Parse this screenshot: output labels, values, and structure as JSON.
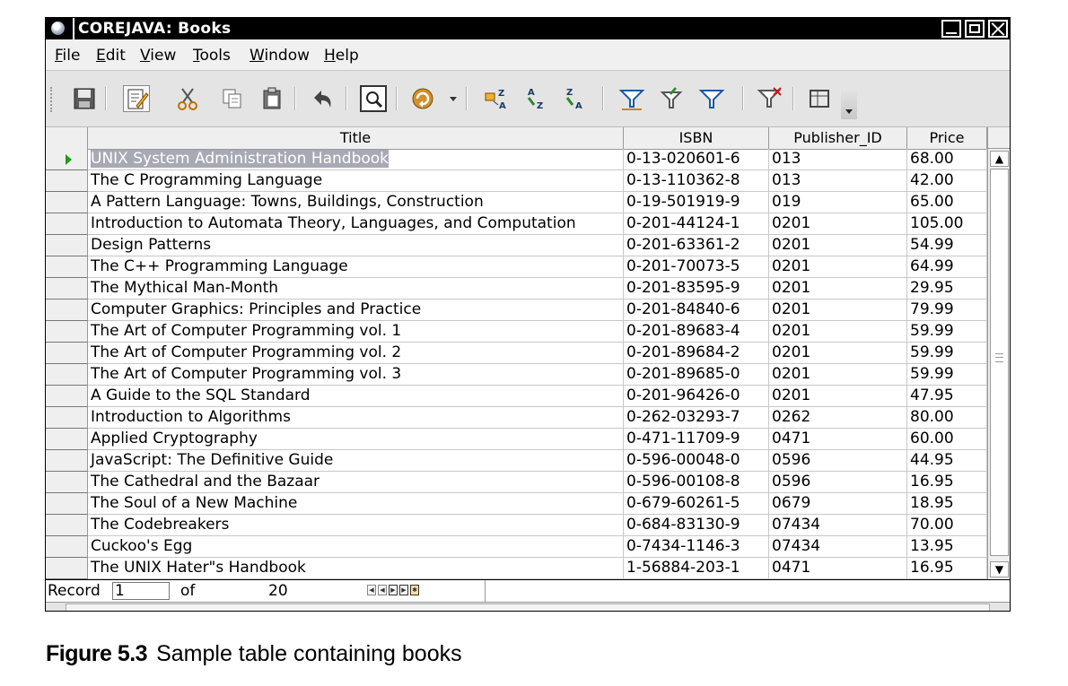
{
  "window": {
    "title": "COREJAVA: Books",
    "icons": {
      "app": "globe-icon",
      "minimize": "minimize-icon",
      "maximize": "maximize-icon",
      "close": "close-icon"
    }
  },
  "menu": [
    "File",
    "Edit",
    "View",
    "Tools",
    "Window",
    "Help"
  ],
  "toolbar": {
    "icons": [
      "save-record-icon",
      "edit-data-icon",
      "cut-icon",
      "copy-icon",
      "paste-icon",
      "undo-icon",
      "find-record-icon",
      "refresh-icon",
      "sort-icon",
      "sort-ascending-icon",
      "sort-descending-icon",
      "autofilter-icon",
      "standard-filter-icon",
      "apply-filter-icon",
      "remove-filter-icon",
      "data-to-text-icon"
    ]
  },
  "table": {
    "columns": [
      "Title",
      "ISBN",
      "Publisher_ID",
      "Price"
    ],
    "rows": [
      [
        "UNIX System Administration Handbook",
        "0-13-020601-6",
        "013",
        "68.00"
      ],
      [
        "The C Programming Language",
        "0-13-110362-8",
        "013",
        "42.00"
      ],
      [
        "A Pattern Language: Towns, Buildings, Construction",
        "0-19-501919-9",
        "019",
        "65.00"
      ],
      [
        "Introduction to Automata Theory, Languages, and Computation",
        "0-201-44124-1",
        "0201",
        "105.00"
      ],
      [
        "Design Patterns",
        "0-201-63361-2",
        "0201",
        "54.99"
      ],
      [
        "The C++ Programming Language",
        "0-201-70073-5",
        "0201",
        "64.99"
      ],
      [
        "The Mythical Man-Month",
        "0-201-83595-9",
        "0201",
        "29.95"
      ],
      [
        "Computer Graphics: Principles and Practice",
        "0-201-84840-6",
        "0201",
        "79.99"
      ],
      [
        "The Art of Computer Programming vol. 1",
        "0-201-89683-4",
        "0201",
        "59.99"
      ],
      [
        "The Art of Computer Programming vol. 2",
        "0-201-89684-2",
        "0201",
        "59.99"
      ],
      [
        "The Art of Computer Programming vol. 3",
        "0-201-89685-0",
        "0201",
        "59.99"
      ],
      [
        "A Guide to the SQL Standard",
        "0-201-96426-0",
        "0201",
        "47.95"
      ],
      [
        "Introduction to Algorithms",
        "0-262-03293-7",
        "0262",
        "80.00"
      ],
      [
        "Applied Cryptography",
        "0-471-11709-9",
        "0471",
        "60.00"
      ],
      [
        "JavaScript: The Definitive Guide",
        "0-596-00048-0",
        "0596",
        "44.95"
      ],
      [
        "The Cathedral and the Bazaar",
        "0-596-00108-8",
        "0596",
        "16.95"
      ],
      [
        "The Soul of a New Machine",
        "0-679-60261-5",
        "0679",
        "18.95"
      ],
      [
        "The Codebreakers",
        "0-684-83130-9",
        "07434",
        "70.00"
      ],
      [
        "Cuckoo's Egg",
        "0-7434-1146-3",
        "07434",
        "13.95"
      ],
      [
        "The UNIX Hater\"s Handbook",
        "1-56884-203-1",
        "0471",
        "16.95"
      ]
    ],
    "active_row": 0
  },
  "record_bar": {
    "label": "Record",
    "current": "1",
    "of": "of",
    "total": "20"
  },
  "caption": {
    "label": "Figure 5.3",
    "text": "Sample table containing books"
  },
  "colors": {
    "selection": "#a7a9b4",
    "row_pointer": "#1a9e1a",
    "titlebar": "#000000"
  }
}
